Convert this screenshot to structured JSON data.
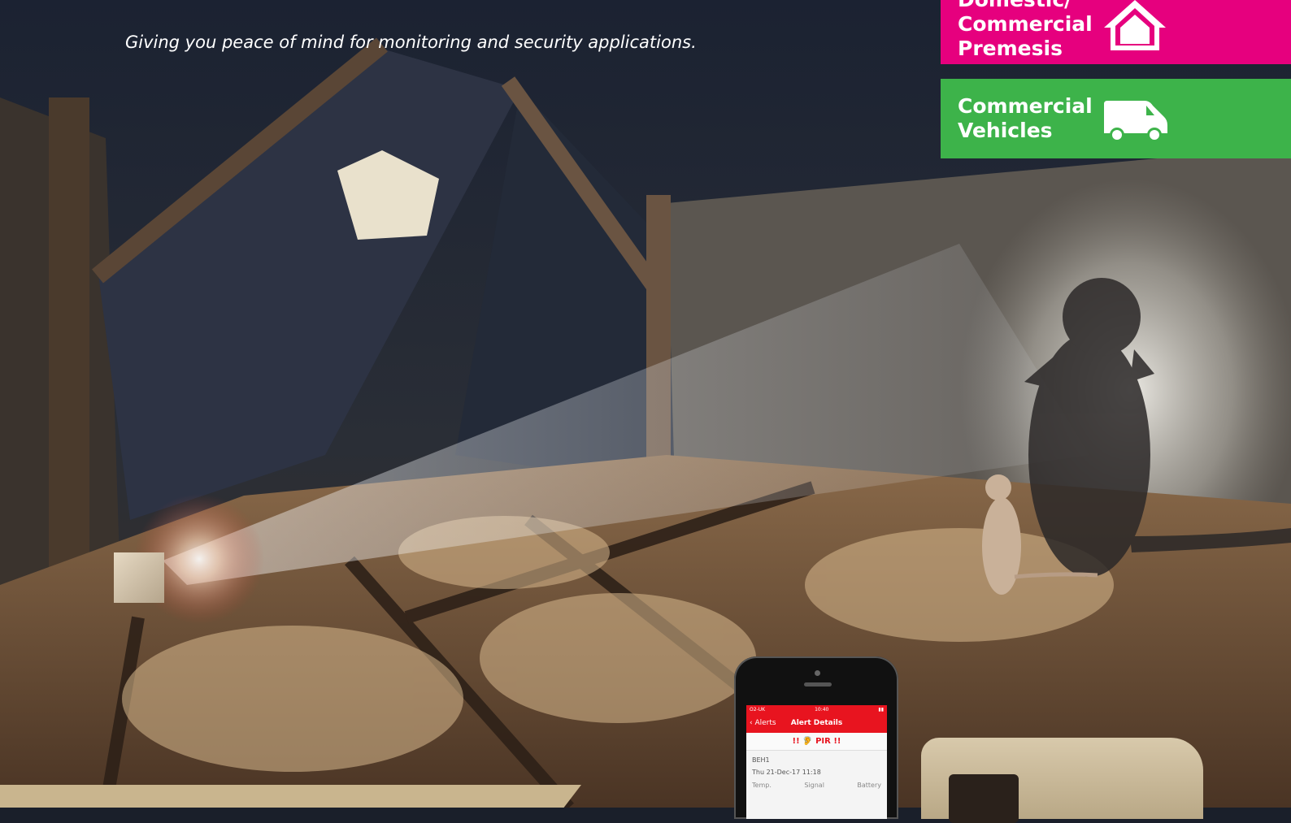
{
  "tagline": "Giving you peace of mind for monitoring and security applications.",
  "categories": [
    {
      "lines": [
        "Domestic/",
        "Commercial",
        "Premesis"
      ],
      "icon": "house-icon",
      "color": "#e6007e"
    },
    {
      "lines": [
        "Commercial",
        "Vehicles"
      ],
      "icon": "van-icon",
      "color": "#3db34a"
    }
  ],
  "phone": {
    "status_left": "O2-UK",
    "status_center": "10:40",
    "back_label": "Alerts",
    "nav_title": "Alert Details",
    "alert_text": "!! 🦻 PIR !!",
    "device_name": "BEH1",
    "timestamp": "Thu 21-Dec-17 11:18",
    "metrics": [
      "Temp.",
      "Signal",
      "Battery"
    ]
  }
}
